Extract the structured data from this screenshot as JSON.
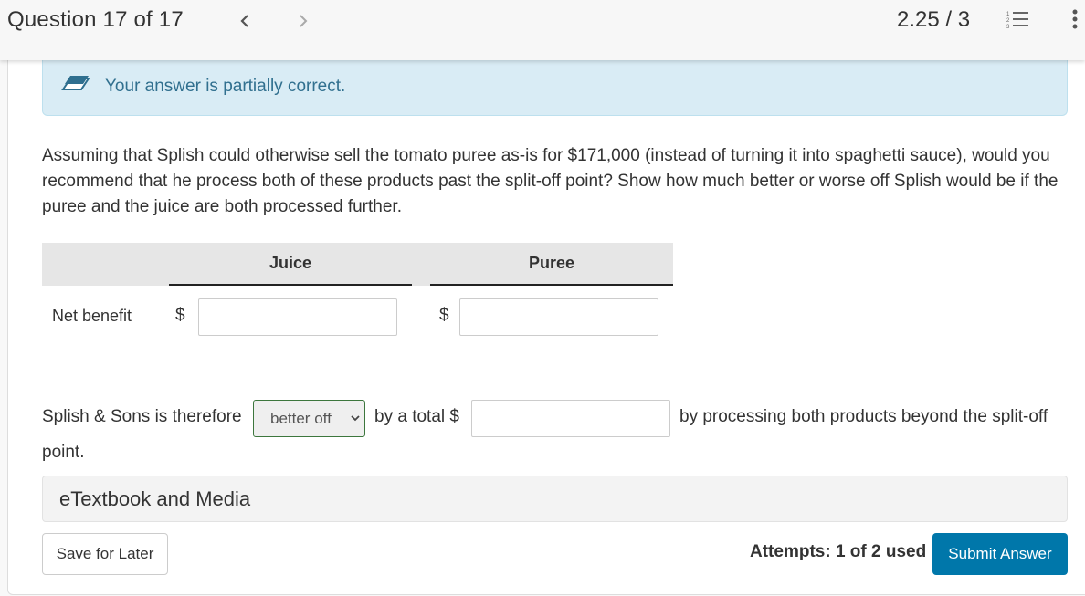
{
  "header": {
    "question_title": "Question 17 of 17",
    "score": "2.25 / 3",
    "prev_icon": "chevron-left-icon",
    "next_icon": "chevron-right-icon",
    "list_icon": "numbered-list-icon",
    "more_icon": "kebab-menu-icon"
  },
  "alert": {
    "icon": "eraser-icon",
    "text": "Your answer is partially correct.",
    "colors": {
      "background": "#d9ecf5",
      "text": "#31708f"
    }
  },
  "question": {
    "text": "Assuming that Splish could otherwise sell the tomato puree as-is for $171,000 (instead of turning it into spaghetti sauce), would you recommend that he process both of these products past the split-off point? Show how much better or worse off Splish would be if the puree and the juice are both processed further."
  },
  "table": {
    "columns": [
      "Juice",
      "Puree"
    ],
    "rows": [
      {
        "label": "Net benefit",
        "currency": "$",
        "juice_value": "",
        "puree_value": ""
      }
    ]
  },
  "conclusion": {
    "prefix": "Splish & Sons is therefore",
    "select_value": "better off",
    "select_status_color": "#3c763d",
    "mid": "by a total $",
    "total_value": "",
    "suffix": "by processing both products beyond the split-off",
    "suffix_wrap": "point."
  },
  "etextbook": {
    "label": "eTextbook and Media"
  },
  "footer": {
    "save_label": "Save for Later",
    "attempts": "Attempts: 1 of 2 used",
    "submit_label": "Submit Answer",
    "submit_color": "#0077aa"
  }
}
